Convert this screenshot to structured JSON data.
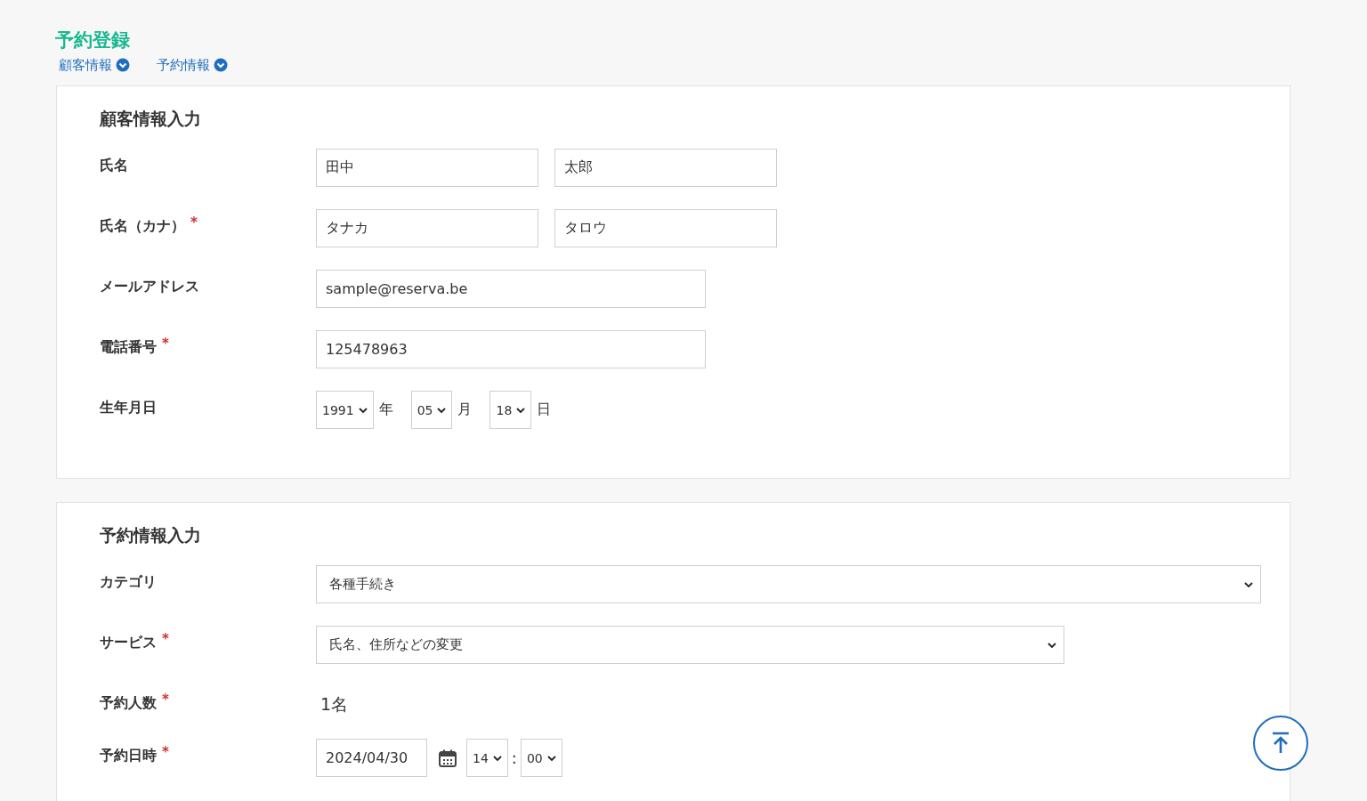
{
  "page_title": "予約登録",
  "nav_links": [
    {
      "label": "顧客情報"
    },
    {
      "label": "予約情報"
    }
  ],
  "sections": [
    {
      "title": "顧客情報入力",
      "rows": [
        {
          "label": "氏名",
          "controls": [
            {
              "kind": "input",
              "value": "田中"
            },
            {
              "kind": "input",
              "value": "太郎"
            }
          ]
        },
        {
          "label": "氏名（カナ）",
          "mark": "*",
          "controls": [
            {
              "kind": "input",
              "value": "タナカ"
            },
            {
              "kind": "input",
              "value": "タロウ"
            }
          ]
        },
        {
          "label": "メールアドレス",
          "controls": [
            {
              "kind": "input_wide",
              "value": "sample@reserva.be"
            }
          ]
        },
        {
          "label": "電話番号",
          "mark": "*",
          "controls": [
            {
              "kind": "input_wide",
              "value": "125478963"
            }
          ]
        },
        {
          "label": "生年月日",
          "controls": [
            {
              "kind": "select_small",
              "value": "1991"
            },
            {
              "kind": "unit",
              "value": "年"
            },
            {
              "kind": "select_small",
              "value": "05"
            },
            {
              "kind": "unit",
              "value": "月"
            },
            {
              "kind": "select_small",
              "value": "18"
            },
            {
              "kind": "unit",
              "value": "日"
            }
          ]
        }
      ]
    },
    {
      "title": "予約情報入力",
      "rows": [
        {
          "label": "カテゴリ",
          "controls": [
            {
              "kind": "select_full",
              "value": "各種手続き"
            }
          ]
        },
        {
          "label": "サービス",
          "mark": "*",
          "controls": [
            {
              "kind": "select_long",
              "value": "氏名、住所などの変更"
            }
          ]
        },
        {
          "label": "予約人数",
          "mark": "*",
          "controls": [
            {
              "kind": "text",
              "value": "1名"
            }
          ]
        },
        {
          "label": "予約日時",
          "mark": "*",
          "controls": [
            {
              "kind": "date",
              "value": "2024/04/30"
            },
            {
              "kind": "calendar"
            },
            {
              "kind": "select_small",
              "value": "14"
            },
            {
              "kind": "sep",
              "value": ":"
            },
            {
              "kind": "select_small",
              "value": "00"
            }
          ]
        }
      ]
    }
  ]
}
